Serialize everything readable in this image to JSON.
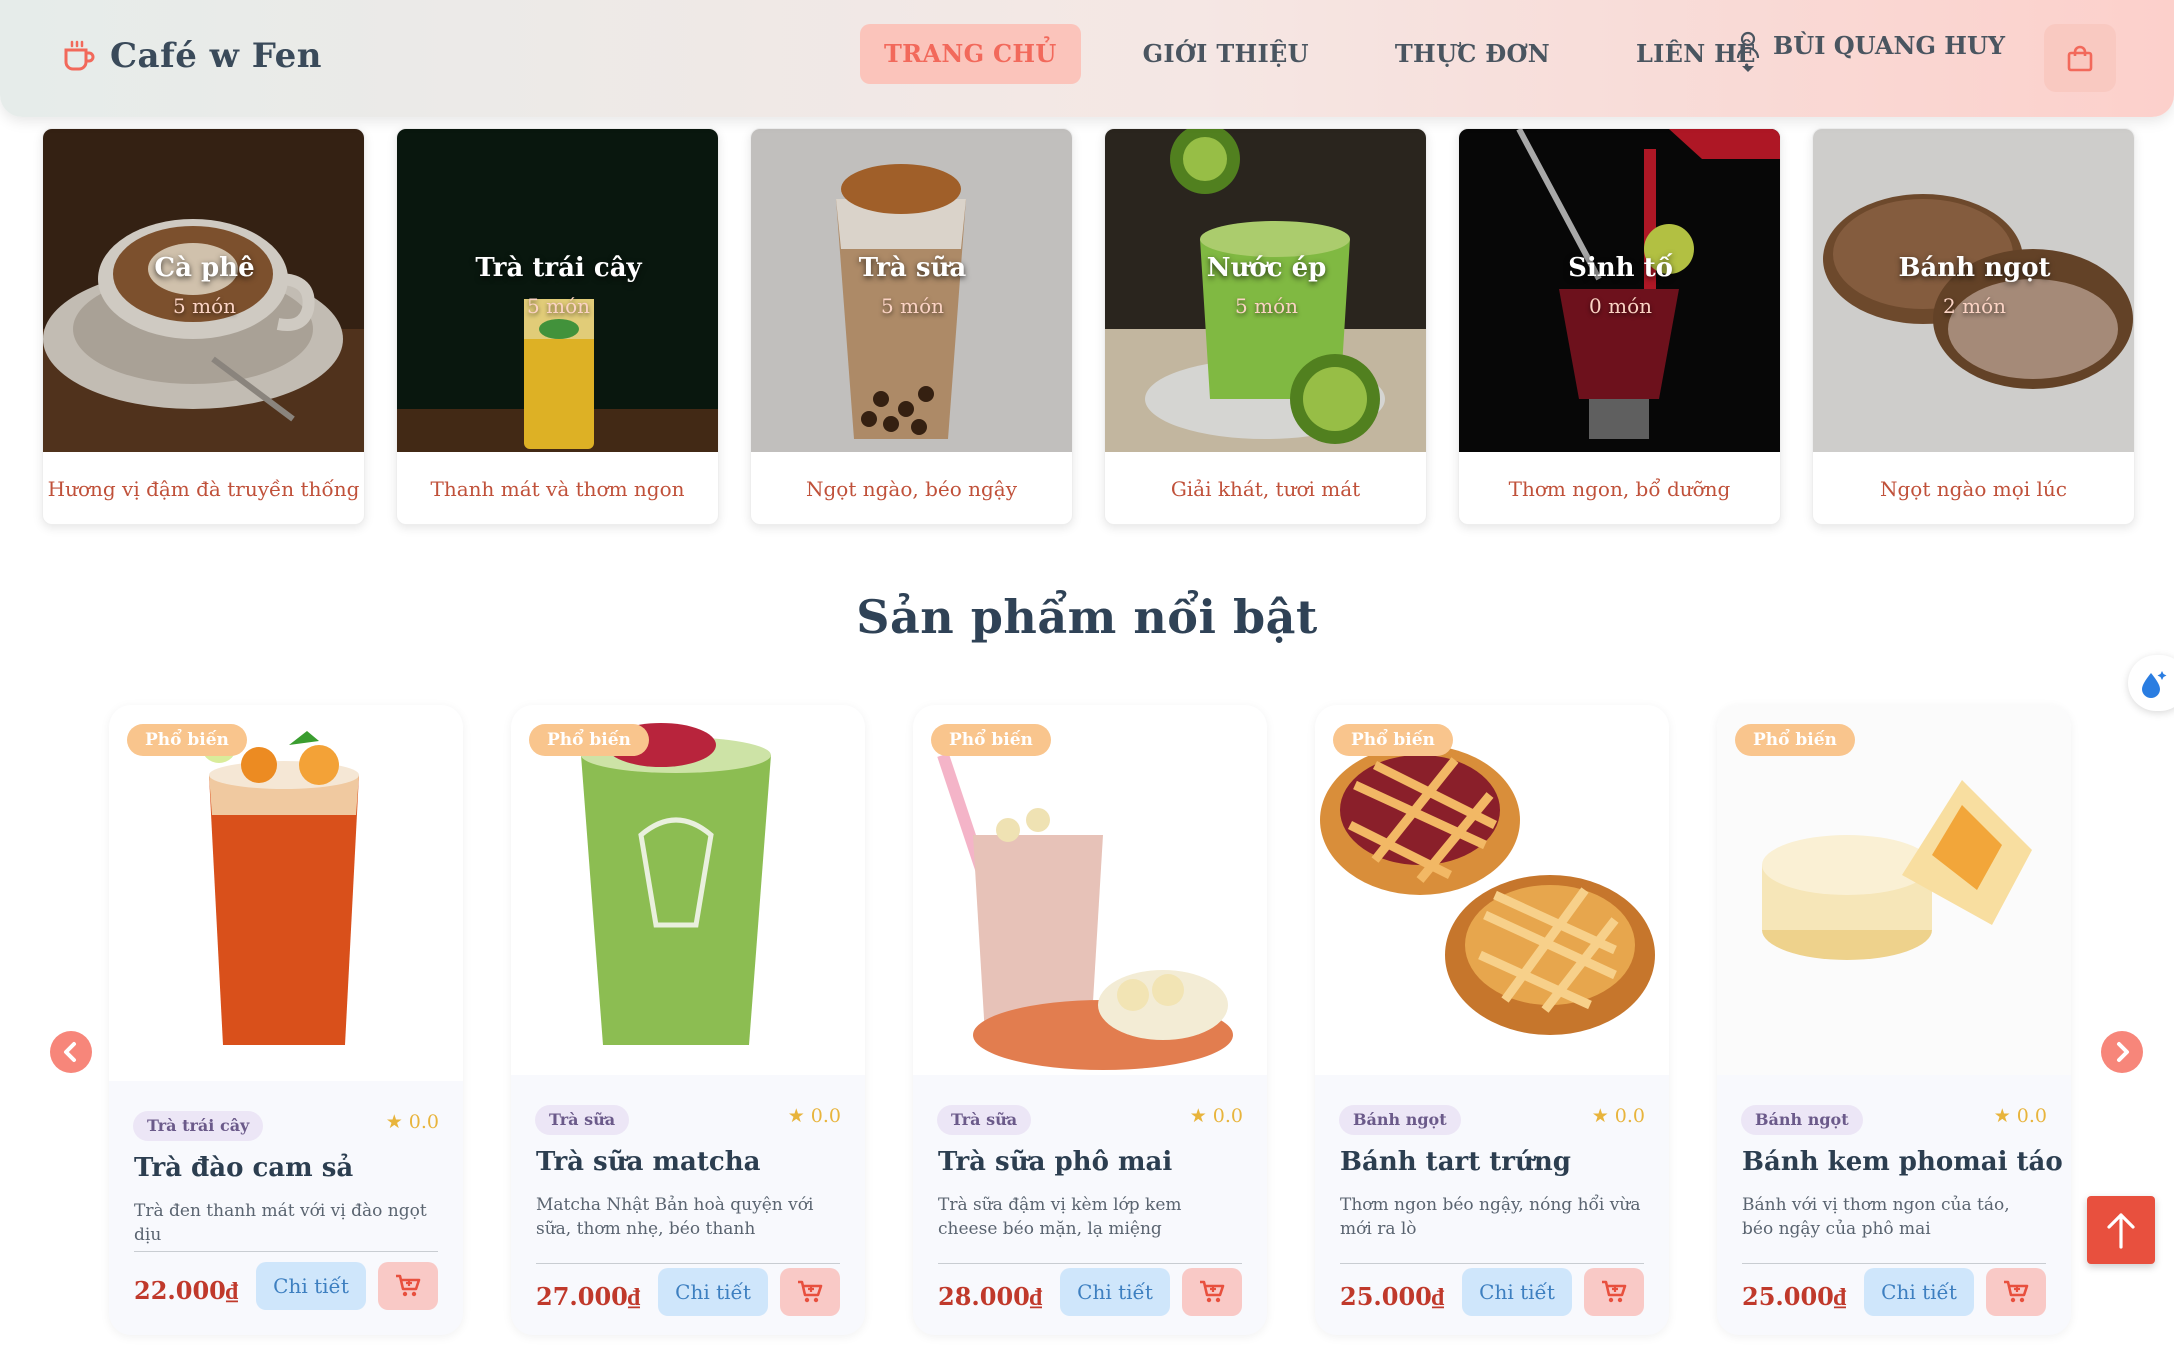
{
  "brand": {
    "name": "Café w Fen"
  },
  "nav": {
    "items": [
      {
        "label": "TRANG CHỦ",
        "active": true
      },
      {
        "label": "GIỚI THIỆU",
        "active": false
      },
      {
        "label": "THỰC ĐƠN",
        "active": false
      },
      {
        "label": "LIÊN HỆ",
        "active": false
      }
    ],
    "user_name": "BÙI QUANG HUY",
    "cart_icon": "shopping-bag-icon"
  },
  "categories": [
    {
      "title": "Cà phê",
      "count": "5 món",
      "desc": "Hương vị đậm đà truyền thống"
    },
    {
      "title": "Trà trái cây",
      "count": "5 món",
      "desc": "Thanh mát và thơm ngon"
    },
    {
      "title": "Trà sữa",
      "count": "5 món",
      "desc": "Ngọt ngào, béo ngậy"
    },
    {
      "title": "Nước ép",
      "count": "5 món",
      "desc": "Giải khát, tươi mát"
    },
    {
      "title": "Sinh tố",
      "count": "0 món",
      "desc": "Thơm ngon, bổ dưỡng"
    },
    {
      "title": "Bánh ngọt",
      "count": "2 món",
      "desc": "Ngọt ngào mọi lúc"
    }
  ],
  "featured": {
    "title": "Sản phẩm nổi bật",
    "products": [
      {
        "badge": "Phổ biến",
        "category": "Trà trái cây",
        "rating": "0.0",
        "name": "Trà đào cam sả",
        "desc": "Trà đen thanh mát với vị đào ngọt dịu",
        "price": "22.000₫",
        "detail_label": "Chi tiết"
      },
      {
        "badge": "Phổ biến",
        "category": "Trà sữa",
        "rating": "0.0",
        "name": "Trà sữa matcha",
        "desc": "Matcha Nhật Bản hoà quyện với sữa, thơm nhẹ, béo thanh",
        "price": "27.000₫",
        "detail_label": "Chi tiết"
      },
      {
        "badge": "Phổ biến",
        "category": "Trà sữa",
        "rating": "0.0",
        "name": "Trà sữa phô mai",
        "desc": "Trà sữa đậm vị kèm lớp kem cheese béo mặn, lạ miệng",
        "price": "28.000₫",
        "detail_label": "Chi tiết"
      },
      {
        "badge": "Phổ biến",
        "category": "Bánh ngọt",
        "rating": "0.0",
        "name": "Bánh tart trứng",
        "desc": "Thơm ngon béo ngậy, nóng hổi vừa mới ra lò",
        "price": "25.000₫",
        "detail_label": "Chi tiết"
      },
      {
        "badge": "Phổ biến",
        "category": "Bánh ngọt",
        "rating": "0.0",
        "name": "Bánh kem phomai táo",
        "desc": "Bánh với vị thơm ngon của táo, béo ngậy của phô mai",
        "price": "25.000₫",
        "detail_label": "Chi tiết"
      }
    ]
  },
  "colors": {
    "accent": "#f2695b",
    "price": "#c0392b",
    "badge": "#f9c58d",
    "scroll_top": "#e8503e"
  },
  "icons": {
    "logo": "coffee-cup-icon",
    "user": "user-icon",
    "star": "star-icon",
    "cart": "cart-icon",
    "prev": "chevron-left-icon",
    "next": "chevron-right-icon",
    "scroll_top": "arrow-up-icon",
    "widget": "water-drop-icon"
  }
}
